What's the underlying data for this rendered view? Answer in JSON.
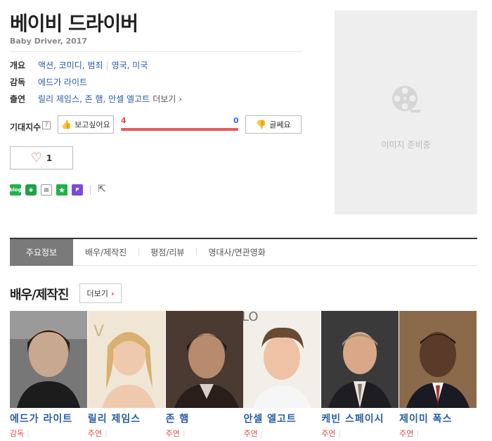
{
  "movie": {
    "title": "베이비 드라이버",
    "subtitle": "Baby Driver, 2017"
  },
  "info": {
    "overview_label": "개요",
    "genres": "액션, 코미디, 범죄",
    "countries": "영국, 미국",
    "director_label": "감독",
    "director": "에드가 라이트",
    "cast_label": "출연",
    "cast": "릴리 제임스, 존 햄, 안셀 엘고트",
    "more": "더보기"
  },
  "expectation": {
    "label": "기대지수",
    "help": "?",
    "want_label": "보고싶어요",
    "meh_label": "글쎄요",
    "want_count": "4",
    "meh_count": "0"
  },
  "like": {
    "count": "1"
  },
  "share": {
    "blog": "blog"
  },
  "poster": {
    "placeholder_text": "이미지 준비중"
  },
  "tabs": [
    {
      "label": "주요정보"
    },
    {
      "label": "배우/제작진"
    },
    {
      "label": "평점/리뷰"
    },
    {
      "label": "명대사/연관영화"
    }
  ],
  "section": {
    "title": "배우/제작진",
    "more_label": "더보기"
  },
  "people": [
    {
      "name": "에드가 라이트",
      "role": "감독"
    },
    {
      "name": "릴리 제임스",
      "role": "주연"
    },
    {
      "name": "존 햄",
      "role": "주연"
    },
    {
      "name": "안셀 엘고트",
      "role": "주연"
    },
    {
      "name": "케빈 스페이시",
      "role": "주연"
    },
    {
      "name": "제이미 폭스",
      "role": "주연"
    }
  ],
  "colors": {
    "link": "#2a5ca8",
    "red": "#e84a4a",
    "blue": "#3a6fd8",
    "tab_active": "#7a7a7a"
  }
}
